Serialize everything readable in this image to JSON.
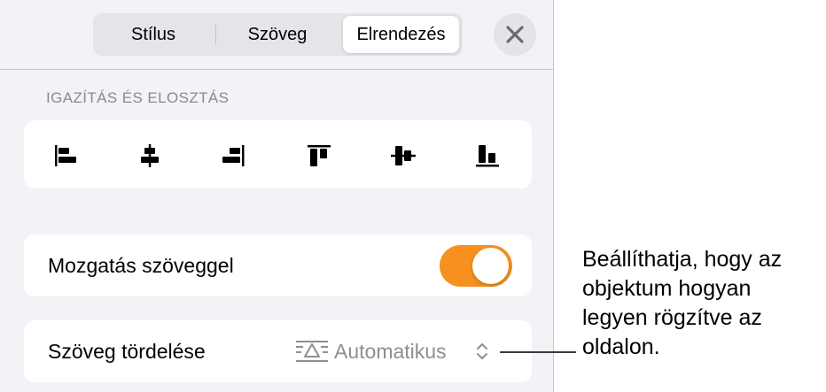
{
  "header": {
    "tabs": [
      "Stílus",
      "Szöveg",
      "Elrendezés"
    ],
    "selected_tab": "Elrendezés",
    "close_icon": "close-icon"
  },
  "section": {
    "title": "IGAZÍTÁS ÉS ELOSZTÁS",
    "icons": [
      "align-left-icon",
      "align-center-horizontal-icon",
      "align-right-icon",
      "align-top-icon",
      "align-middle-vertical-icon",
      "align-bottom-icon"
    ]
  },
  "move_with_text": {
    "label": "Mozgatás szöveggel",
    "enabled": true,
    "toggle_color": "#f7901e"
  },
  "text_wrap": {
    "label": "Szöveg tördelése",
    "value": "Automatikus",
    "icon": "text-wrap-icon",
    "chevron": "chevron-up-down-icon"
  },
  "callout": {
    "lines": [
      "Beállíthatja, hogy az",
      "objektum hogyan",
      "legyen rögzítve az",
      "oldalon."
    ]
  }
}
